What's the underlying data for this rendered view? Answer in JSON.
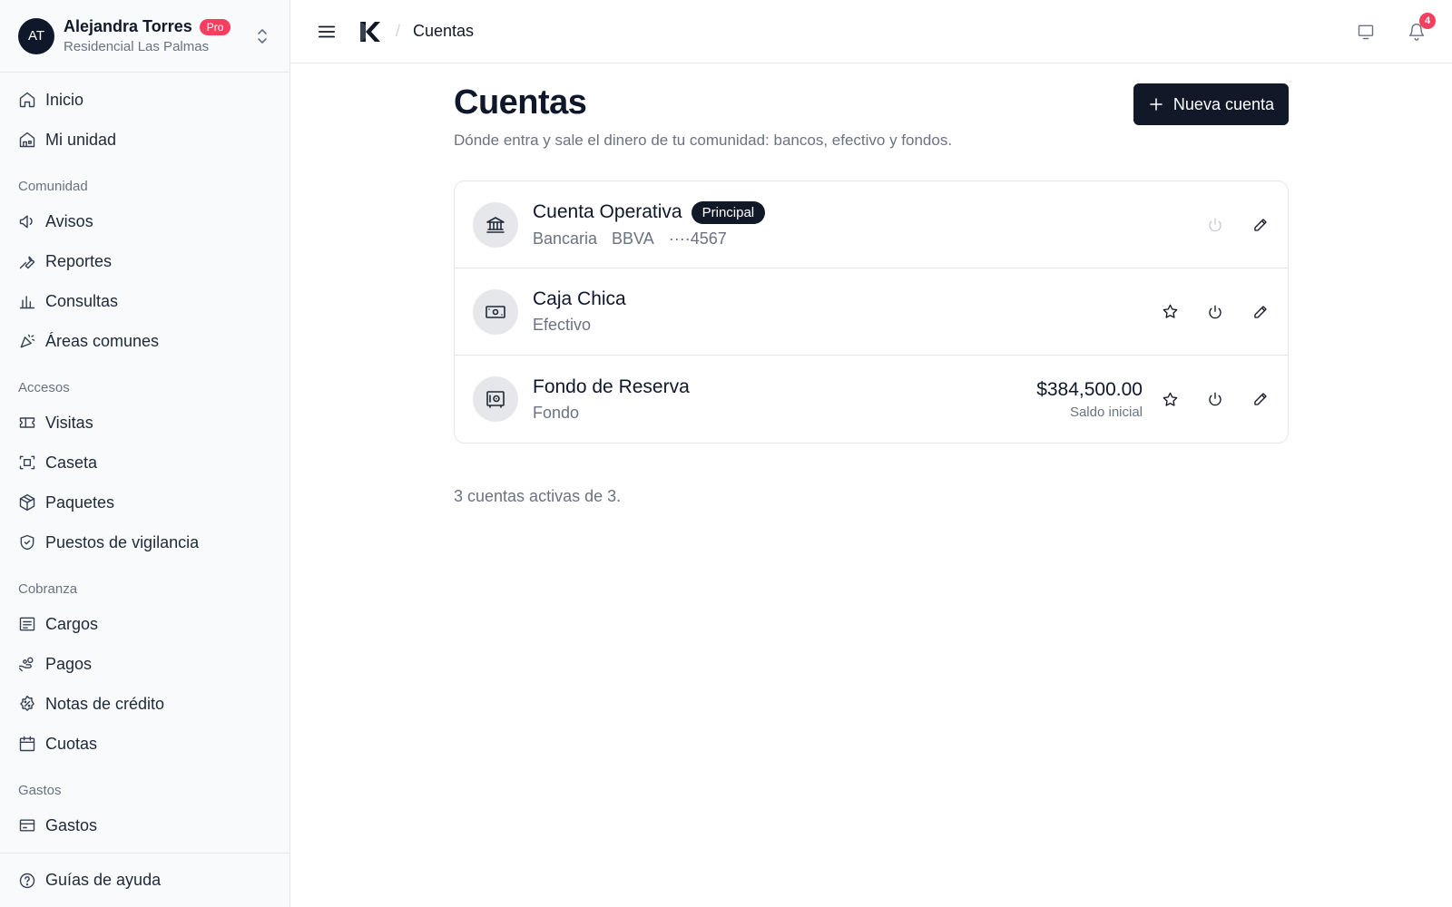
{
  "user": {
    "initials": "AT",
    "name": "Alejandra Torres",
    "badge": "Pro",
    "community": "Residencial Las Palmas"
  },
  "sidebar": {
    "top_items": [
      {
        "label": "Inicio",
        "icon": "home-icon"
      },
      {
        "label": "Mi unidad",
        "icon": "unit-icon"
      }
    ],
    "sections": [
      {
        "title": "Comunidad",
        "items": [
          {
            "label": "Avisos",
            "icon": "megaphone-icon"
          },
          {
            "label": "Reportes",
            "icon": "wrench-icon"
          },
          {
            "label": "Consultas",
            "icon": "bar-chart-icon"
          },
          {
            "label": "Áreas comunes",
            "icon": "party-icon"
          }
        ]
      },
      {
        "title": "Accesos",
        "items": [
          {
            "label": "Visitas",
            "icon": "ticket-icon"
          },
          {
            "label": "Caseta",
            "icon": "scan-icon"
          },
          {
            "label": "Paquetes",
            "icon": "package-icon"
          },
          {
            "label": "Puestos de vigilancia",
            "icon": "shield-icon"
          }
        ]
      },
      {
        "title": "Cobranza",
        "items": [
          {
            "label": "Cargos",
            "icon": "receipt-icon"
          },
          {
            "label": "Pagos",
            "icon": "hand-coins-icon"
          },
          {
            "label": "Notas de crédito",
            "icon": "badge-percent-icon"
          },
          {
            "label": "Cuotas",
            "icon": "calendar-icon"
          }
        ]
      },
      {
        "title": "Gastos",
        "items": [
          {
            "label": "Gastos",
            "icon": "expenses-icon"
          }
        ]
      }
    ],
    "footer_label": "Guías de ayuda"
  },
  "topbar": {
    "breadcrumb": "Cuentas",
    "notification_count": "4"
  },
  "page": {
    "title": "Cuentas",
    "subtitle": "Dónde entra y sale el dinero de tu comunidad: bancos, efectivo y fondos.",
    "new_button": "Nueva cuenta",
    "footer_note": "3 cuentas activas de 3."
  },
  "accounts": [
    {
      "name": "Cuenta Operativa",
      "badge": "Principal",
      "type": "Bancaria",
      "bank": "BBVA",
      "number": "····4567",
      "icon": "bank-icon"
    },
    {
      "name": "Caja Chica",
      "type": "Efectivo",
      "icon": "cash-icon"
    },
    {
      "name": "Fondo de Reserva",
      "type": "Fondo",
      "amount": "$384,500.00",
      "amount_label": "Saldo inicial",
      "icon": "safe-icon"
    }
  ],
  "colors": {
    "primary": "#111827",
    "badge_red": "#f43f5e",
    "muted": "#6b7280"
  }
}
